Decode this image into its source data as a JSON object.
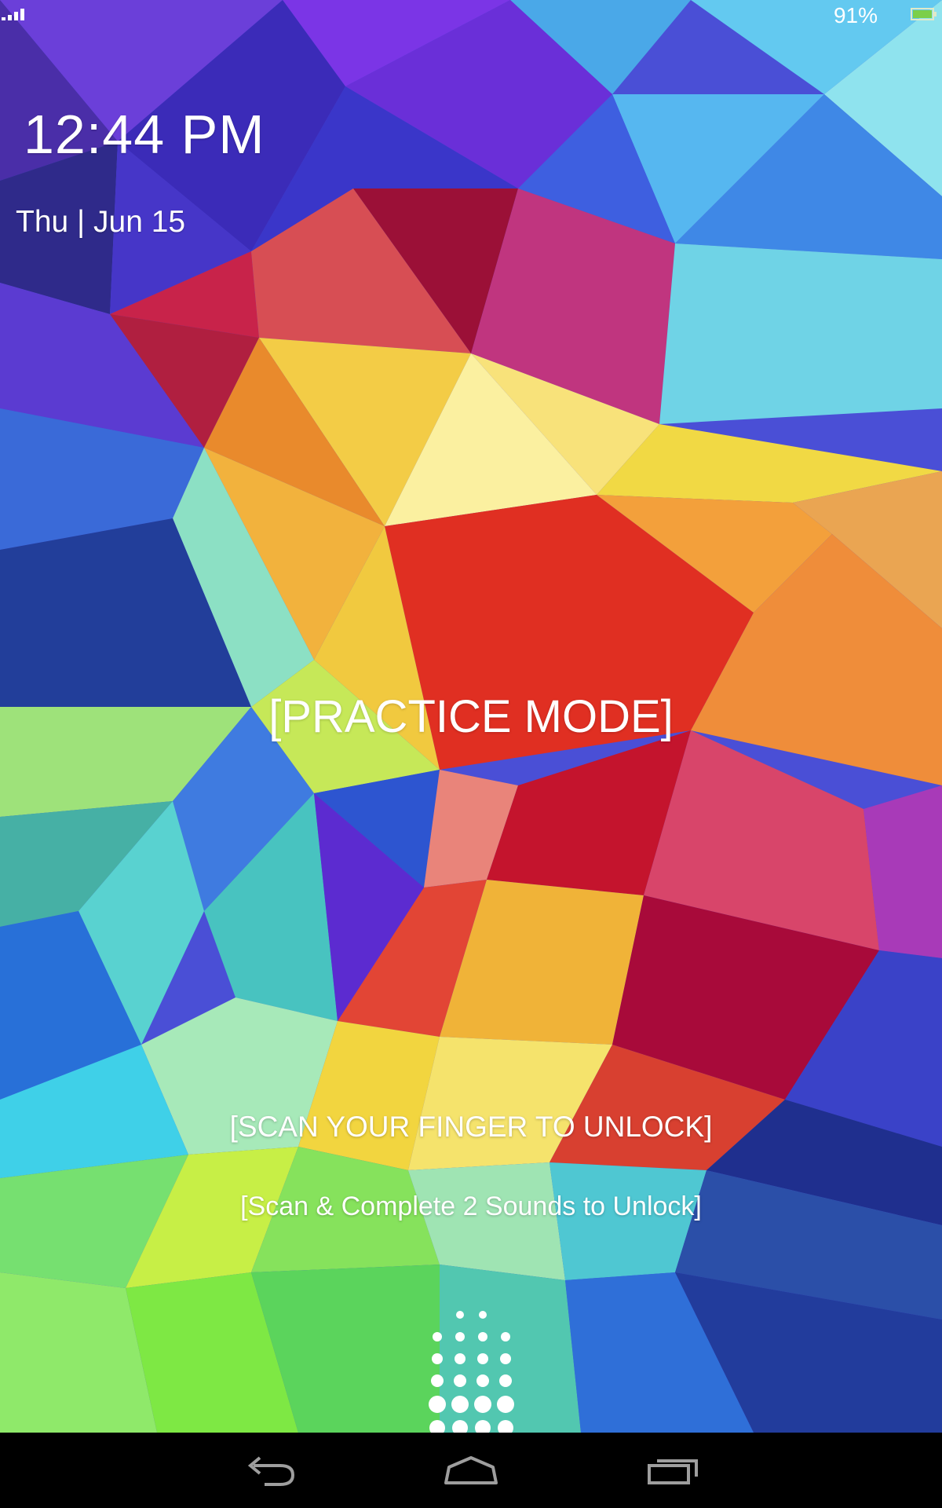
{
  "status_bar": {
    "battery_percent": "91%",
    "signal_icon": "signal-bars-icon",
    "battery_icon": "battery-icon",
    "battery_color": "#7ccf4a"
  },
  "lockscreen": {
    "time": "12:44 PM",
    "date": "Thu | Jun 15",
    "mode_label": "[PRACTICE MODE]",
    "instruction": "[SCAN YOUR FINGER TO UNLOCK]",
    "sub_instruction": "[Scan & Complete 2 Sounds to Unlock]",
    "fingerprint_icon": "fingerprint-scanner-icon"
  },
  "navigation_bar": {
    "back_icon": "back-icon",
    "home_icon": "home-icon",
    "recents_icon": "recent-apps-icon"
  }
}
